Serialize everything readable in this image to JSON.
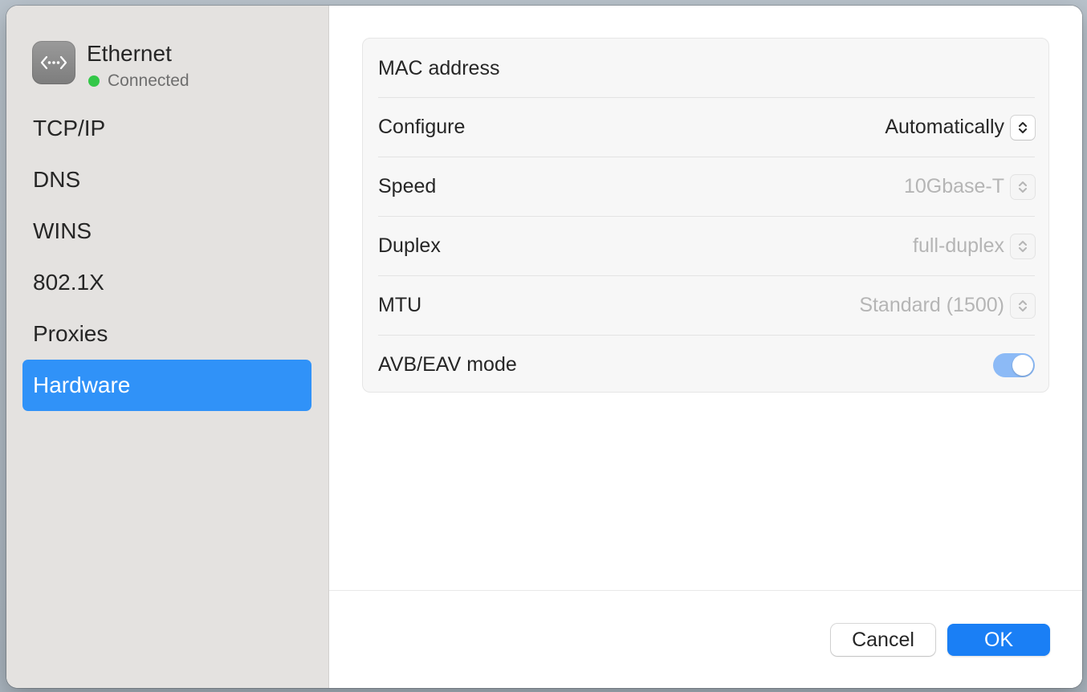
{
  "interface": {
    "name": "Ethernet",
    "status": "Connected",
    "icon": "ethernet-icon",
    "status_color": "#33c748"
  },
  "sidebar": {
    "items": [
      {
        "label": "TCP/IP"
      },
      {
        "label": "DNS"
      },
      {
        "label": "WINS"
      },
      {
        "label": "802.1X"
      },
      {
        "label": "Proxies"
      },
      {
        "label": "Hardware",
        "selected": true
      }
    ]
  },
  "hardware": {
    "mac_address_label": "MAC address",
    "configure": {
      "label": "Configure",
      "value": "Automatically"
    },
    "speed": {
      "label": "Speed",
      "value": "10Gbase-T",
      "enabled": false
    },
    "duplex": {
      "label": "Duplex",
      "value": "full-duplex",
      "enabled": false
    },
    "mtu": {
      "label": "MTU",
      "value": "Standard (1500)",
      "enabled": false
    },
    "avb_eav": {
      "label": "AVB/EAV mode",
      "on": true
    }
  },
  "footer": {
    "cancel_label": "Cancel",
    "ok_label": "OK"
  },
  "colors": {
    "accent": "#1a7ff5",
    "selection": "#3092f8",
    "toggle_on": "#8cbaf6"
  }
}
